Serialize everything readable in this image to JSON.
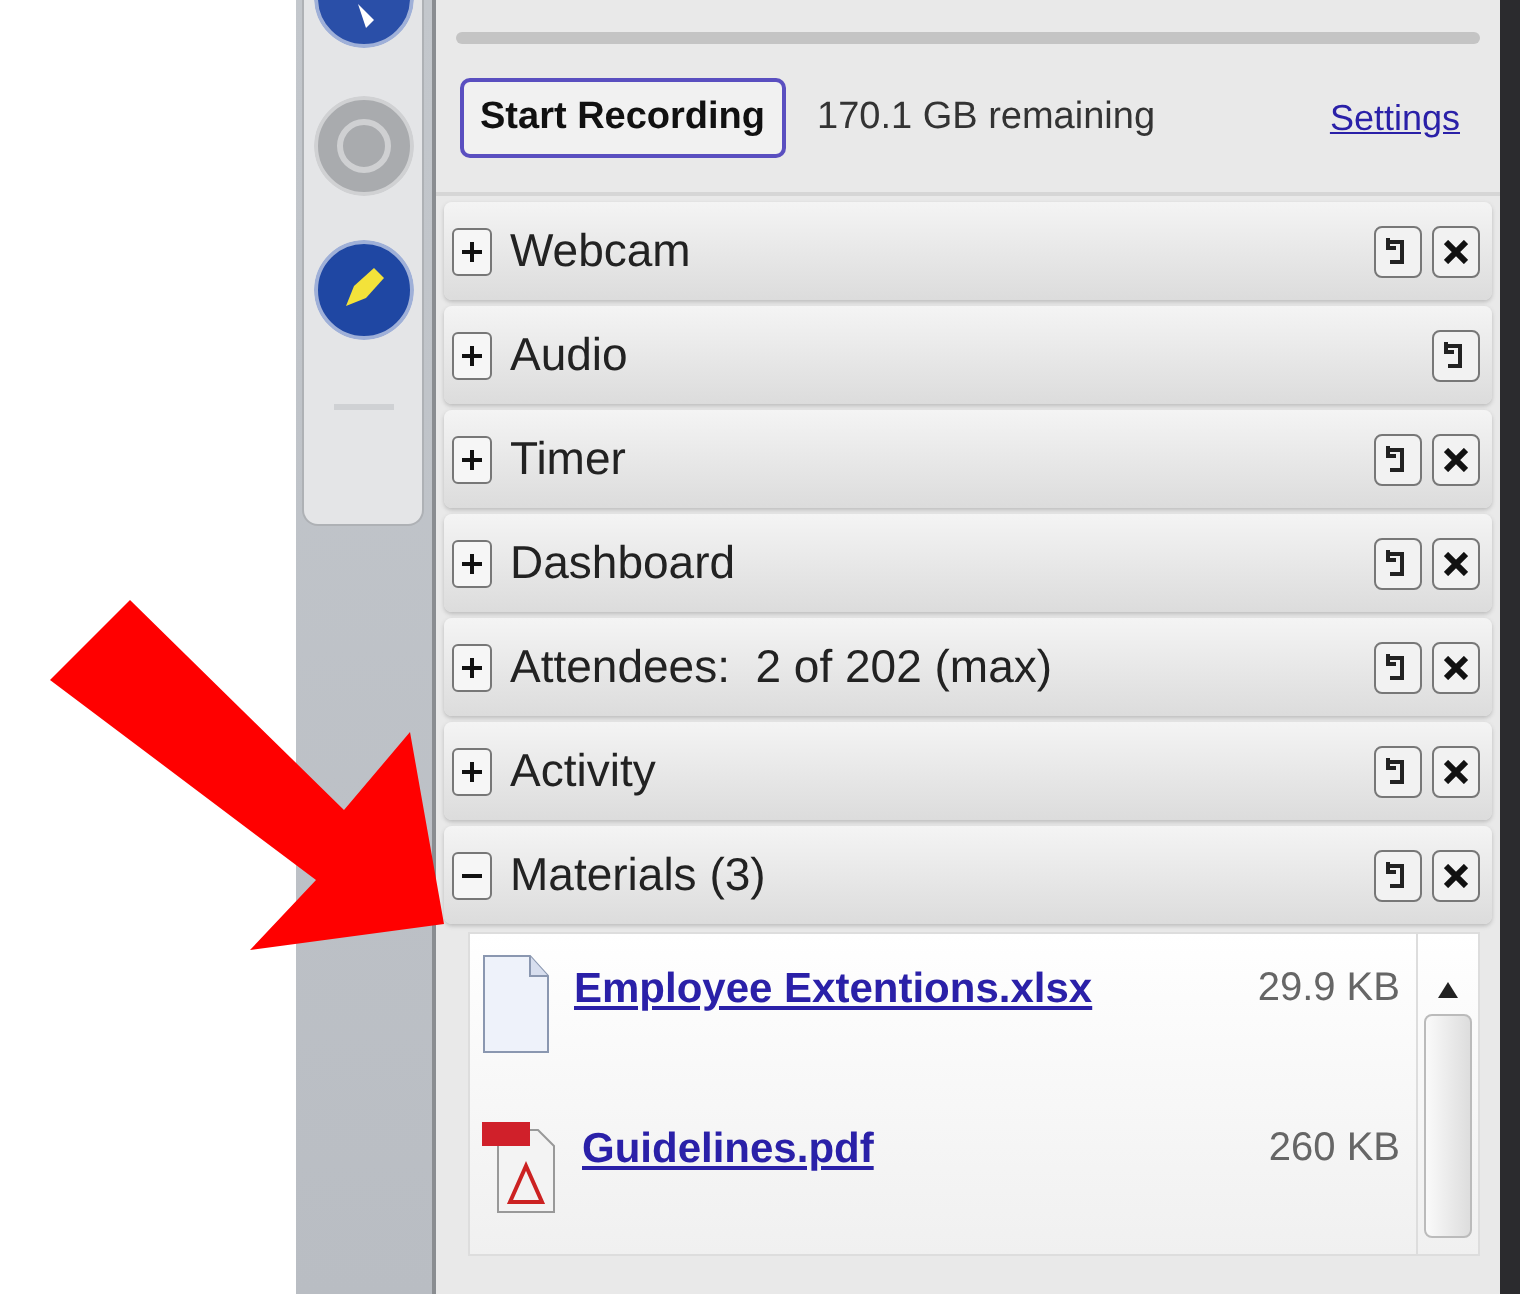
{
  "recording": {
    "button": "Start Recording",
    "remaining": "170.1 GB remaining",
    "settings_link": "Settings"
  },
  "panels": [
    {
      "label": "Webcam",
      "expanded": false,
      "closable": true
    },
    {
      "label": "Audio",
      "expanded": false,
      "closable": false
    },
    {
      "label": "Timer",
      "expanded": false,
      "closable": true
    },
    {
      "label": "Dashboard",
      "expanded": false,
      "closable": true
    },
    {
      "label": "Attendees:  2 of 202 (max)",
      "expanded": false,
      "closable": true
    },
    {
      "label": "Activity",
      "expanded": false,
      "closable": true
    },
    {
      "label": "Materials (3)",
      "expanded": true,
      "closable": true,
      "files": [
        {
          "name": "Employee Extentions.xlsx",
          "size": "29.9 KB",
          "kind": "document"
        },
        {
          "name": "Guidelines.pdf",
          "size": "260 KB",
          "kind": "pdf"
        }
      ]
    }
  ]
}
